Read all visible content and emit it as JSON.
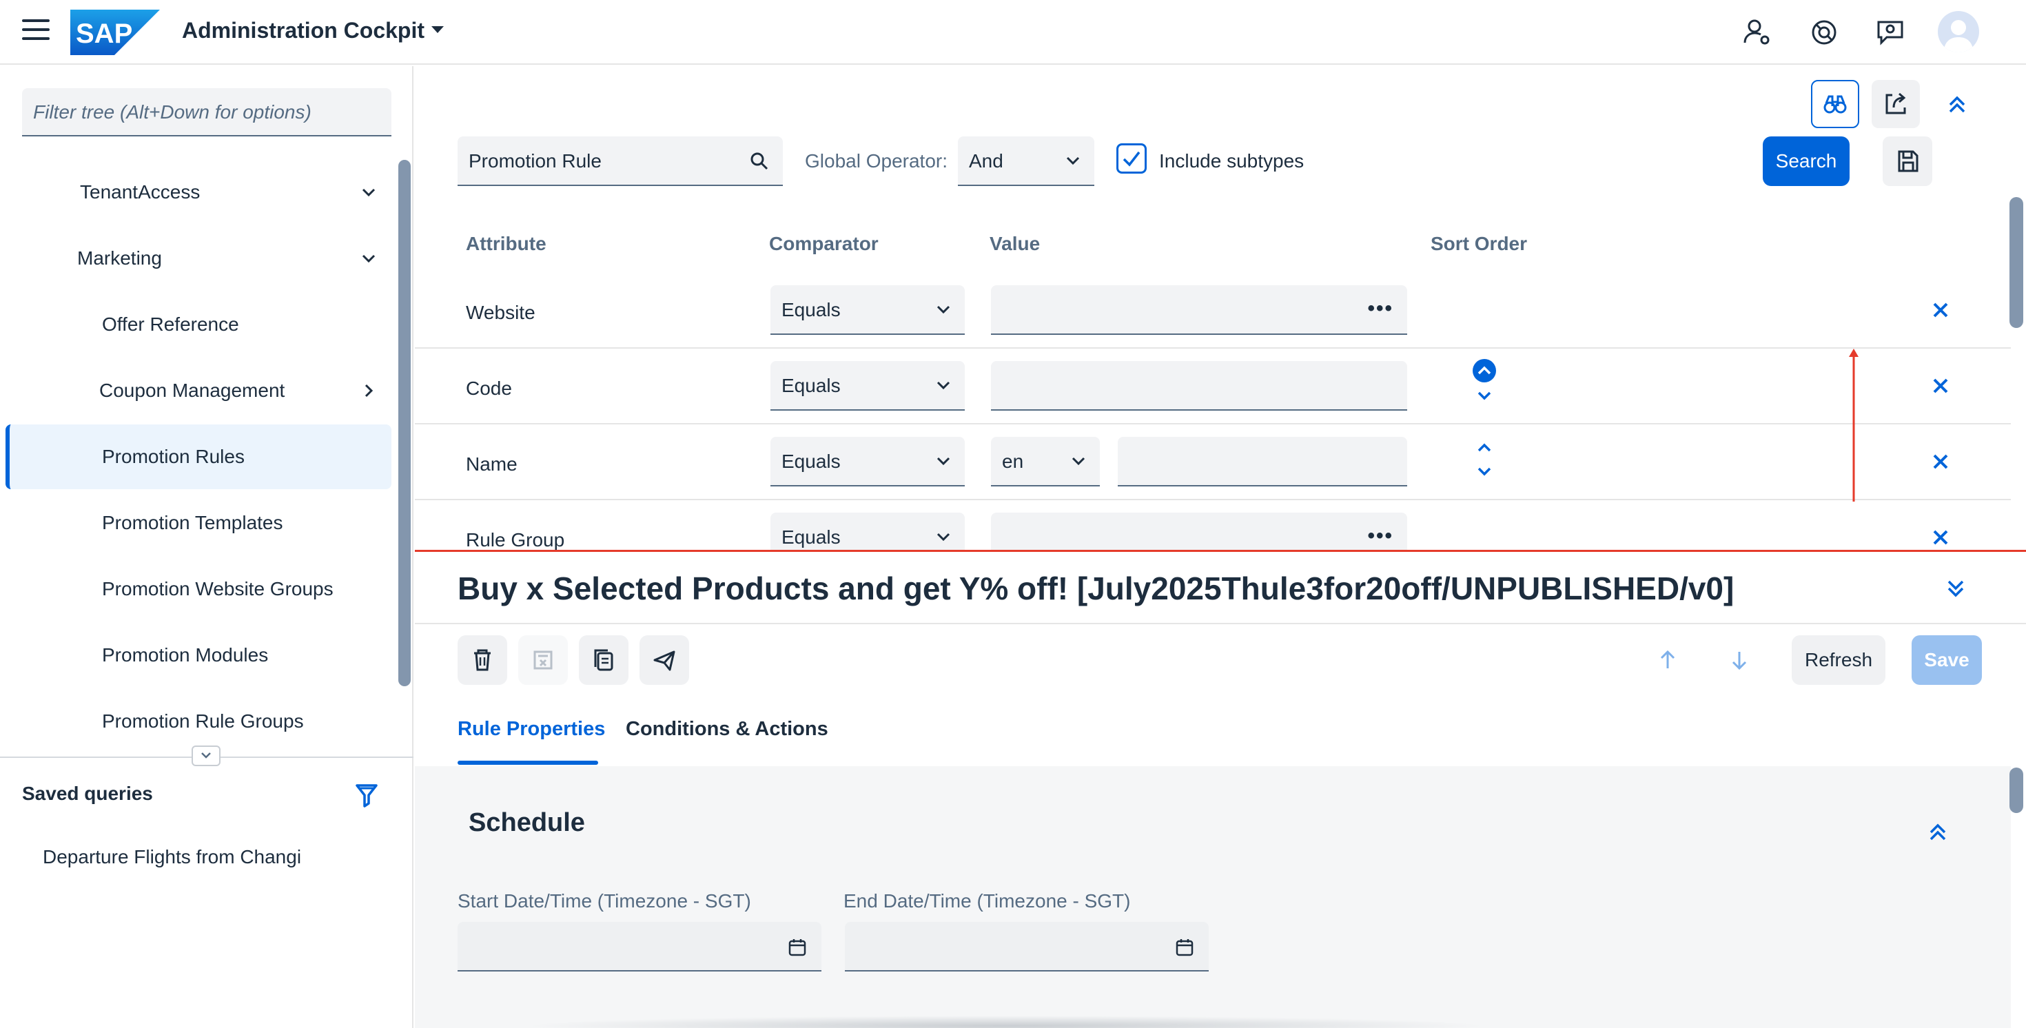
{
  "shell": {
    "title": "Administration Cockpit",
    "logo_text": "SAP",
    "icons": [
      "user-settings-icon",
      "help-icon",
      "feedback-icon",
      "avatar-icon"
    ]
  },
  "left": {
    "filter_placeholder": "Filter tree (Alt+Down for options)",
    "tree": [
      {
        "label": "TenantAccess",
        "expand": "down"
      },
      {
        "label": "Marketing",
        "expand": "down"
      },
      {
        "label": "Offer Reference",
        "expand": ""
      },
      {
        "label": "Coupon Management",
        "expand": "right"
      },
      {
        "label": "Promotion Rules",
        "expand": "",
        "selected": true
      },
      {
        "label": "Promotion Templates",
        "expand": ""
      },
      {
        "label": "Promotion Website Groups",
        "expand": ""
      },
      {
        "label": "Promotion Modules",
        "expand": ""
      },
      {
        "label": "Promotion Rule Groups",
        "expand": ""
      }
    ],
    "saved_queries_title": "Saved queries",
    "saved_queries": [
      "Departure Flights from Changi"
    ]
  },
  "search": {
    "type_value": "Promotion Rule",
    "global_operator_label": "Global Operator:",
    "global_operator_value": "And",
    "include_subtypes_label": "Include subtypes",
    "include_subtypes_checked": true,
    "search_button": "Search",
    "columns": {
      "attribute": "Attribute",
      "comparator": "Comparator",
      "value": "Value",
      "sort_order": "Sort Order"
    },
    "rows": [
      {
        "attribute": "Website",
        "comparator": "Equals",
        "value": "",
        "has_dots": true,
        "lang": ""
      },
      {
        "attribute": "Code",
        "comparator": "Equals",
        "value": "",
        "has_dots": false,
        "lang": ""
      },
      {
        "attribute": "Name",
        "comparator": "Equals",
        "value": "",
        "has_dots": false,
        "lang": "en"
      },
      {
        "attribute": "Rule Group",
        "comparator": "Equals",
        "value": "",
        "has_dots": true,
        "lang": ""
      }
    ]
  },
  "detail": {
    "title": "Buy x Selected Products and get Y% off! [July2025Thule3for20off/UNPUBLISHED/v0]",
    "refresh_button": "Refresh",
    "save_button": "Save",
    "tabs": [
      "Rule Properties",
      "Conditions & Actions"
    ],
    "active_tab": "Rule Properties",
    "section_title": "Schedule",
    "start_label": "Start Date/Time (Timezone - SGT)",
    "end_label": "End Date/Time (Timezone - SGT)",
    "start_value": "",
    "end_value": ""
  },
  "colors": {
    "accent": "#0064d9",
    "annotation_red": "#e53b2b"
  }
}
